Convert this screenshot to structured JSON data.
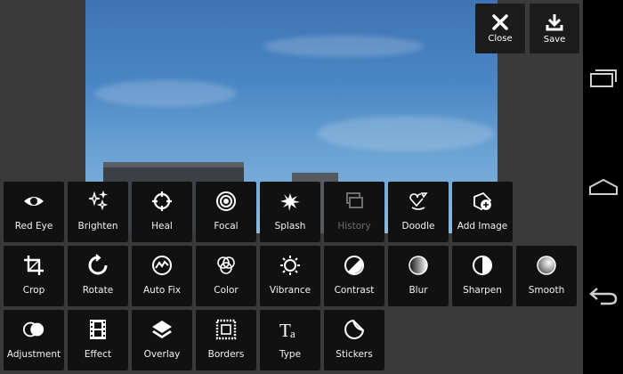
{
  "topbar": {
    "close_label": "Close",
    "save_label": "Save"
  },
  "tools": [
    {
      "label": "Red Eye",
      "icon": "eye-icon",
      "disabled": false
    },
    {
      "label": "Brighten",
      "icon": "sparkles-icon",
      "disabled": false
    },
    {
      "label": "Heal",
      "icon": "crosshair-icon",
      "disabled": false
    },
    {
      "label": "Focal",
      "icon": "target-icon",
      "disabled": false
    },
    {
      "label": "Splash",
      "icon": "splash-icon",
      "disabled": false
    },
    {
      "label": "History",
      "icon": "history-icon",
      "disabled": true
    },
    {
      "label": "Doodle",
      "icon": "doodle-icon",
      "disabled": false
    },
    {
      "label": "Add Image",
      "icon": "add-image-icon",
      "disabled": false
    },
    {
      "label": "Crop",
      "icon": "crop-icon",
      "disabled": false
    },
    {
      "label": "Rotate",
      "icon": "rotate-icon",
      "disabled": false
    },
    {
      "label": "Auto Fix",
      "icon": "auto-fix-icon",
      "disabled": false
    },
    {
      "label": "Color",
      "icon": "color-circles-icon",
      "disabled": false
    },
    {
      "label": "Vibrance",
      "icon": "sun-icon",
      "disabled": false
    },
    {
      "label": "Contrast",
      "icon": "contrast-icon",
      "disabled": false
    },
    {
      "label": "Blur",
      "icon": "blur-icon",
      "disabled": false
    },
    {
      "label": "Sharpen",
      "icon": "sharpen-icon",
      "disabled": false
    },
    {
      "label": "Smooth",
      "icon": "smooth-icon",
      "disabled": false
    },
    {
      "label": "Adjustment",
      "icon": "adjustment-icon",
      "disabled": false
    },
    {
      "label": "Effect",
      "icon": "film-icon",
      "disabled": false
    },
    {
      "label": "Overlay",
      "icon": "layers-icon",
      "disabled": false
    },
    {
      "label": "Borders",
      "icon": "border-frame-icon",
      "disabled": false
    },
    {
      "label": "Type",
      "icon": "type-icon",
      "disabled": false
    },
    {
      "label": "Stickers",
      "icon": "sticker-icon",
      "disabled": false
    }
  ],
  "navbar": {
    "buttons": [
      "recent-apps-icon",
      "home-icon",
      "back-icon"
    ]
  },
  "colors": {
    "tile_bg": "#111111",
    "app_bg": "#3a3a3a",
    "disabled_text": "#6e6e6e"
  }
}
